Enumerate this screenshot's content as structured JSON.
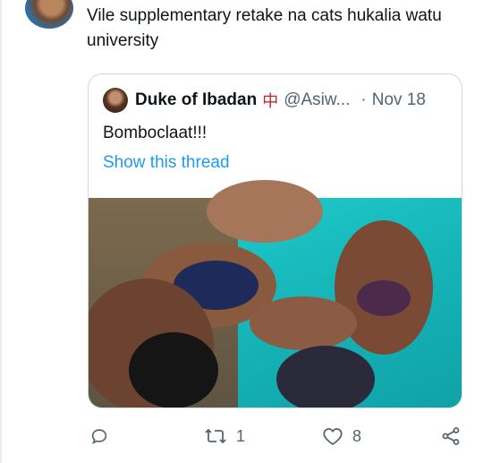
{
  "tweet": {
    "text": "Vile supplementary retake na cats hukalia watu university"
  },
  "quote": {
    "name": "Duke of Ibadan",
    "badge": "中",
    "handle": "@Asiw...",
    "separator": "·",
    "date": "Nov 18",
    "text": "Bomboclaat!!!",
    "thread_link": "Show this thread"
  },
  "actions": {
    "reply_icon": "reply-icon",
    "retweet_icon": "retweet-icon",
    "retweet_count": "1",
    "like_icon": "heart-icon",
    "like_count": "8",
    "share_icon": "share-icon"
  },
  "colors": {
    "link": "#1d9bf0",
    "secondary_text": "#536471",
    "border": "#cfd9de"
  }
}
